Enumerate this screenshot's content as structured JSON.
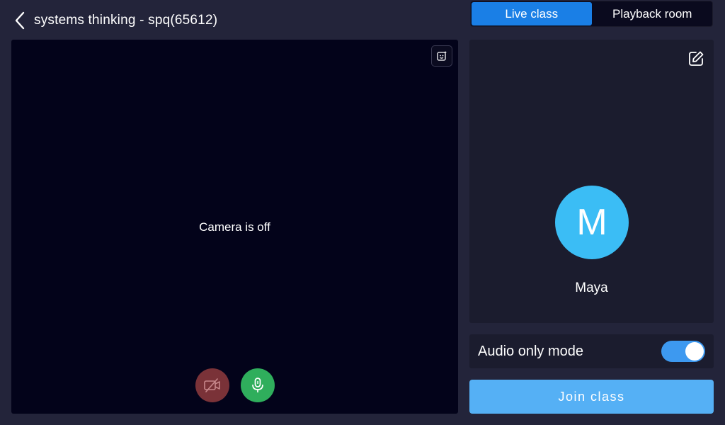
{
  "header": {
    "back_icon": "chevron-left-icon",
    "title": "systems thinking - spq(65612)"
  },
  "tabs": [
    {
      "label": "Live class",
      "active": true
    },
    {
      "label": "Playback room",
      "active": false
    }
  ],
  "video": {
    "camera_status": "Camera is off",
    "beauty_icon": "beauty-filter-icon",
    "camera_button": {
      "icon": "camera-off-icon",
      "state": "off"
    },
    "mic_button": {
      "icon": "microphone-icon",
      "state": "on"
    }
  },
  "profile": {
    "edit_icon": "edit-icon",
    "avatar_initial": "M",
    "name": "Maya"
  },
  "audio_only": {
    "label": "Audio only mode",
    "enabled": true
  },
  "join_button": {
    "label": "Join class"
  },
  "colors": {
    "background": "#23243a",
    "accent": "#1a7fe6",
    "join": "#55b0f5",
    "avatar": "#3bbdf5",
    "mic_on": "#2fae5c",
    "camera_off": "#7a3238"
  }
}
